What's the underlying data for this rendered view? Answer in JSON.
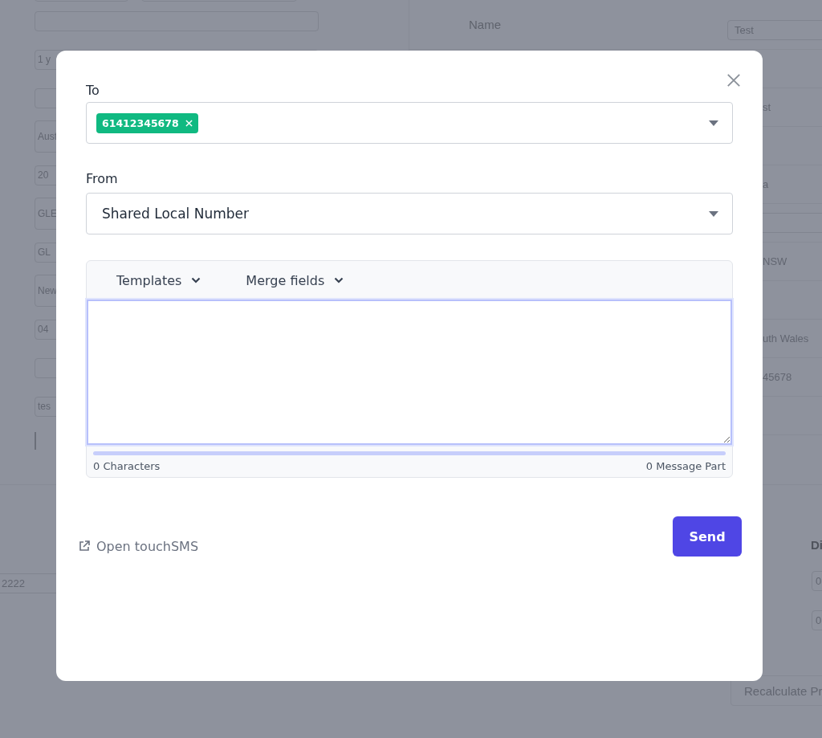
{
  "background": {
    "left_fields": [
      {
        "kind": "blank"
      },
      {
        "kind": "text",
        "value": "1 y"
      },
      {
        "kind": "blank"
      },
      {
        "kind": "text",
        "value": "Aust"
      },
      {
        "kind": "text",
        "value": "20"
      },
      {
        "kind": "text",
        "value": "GLE"
      },
      {
        "kind": "text",
        "value": "GL"
      },
      {
        "kind": "text",
        "value": "New"
      },
      {
        "kind": "text",
        "value": "04"
      },
      {
        "kind": "blank"
      },
      {
        "kind": "text",
        "value": "tes"
      }
    ],
    "right_label": "Name",
    "right_fields": [
      {
        "kind": "text",
        "value": "Test"
      },
      {
        "kind": "blank"
      },
      {
        "kind": "text",
        "value": "st"
      },
      {
        "kind": "blank"
      },
      {
        "kind": "text",
        "value": "a"
      },
      {
        "kind": "blank"
      },
      {
        "kind": "text",
        "value": "NSW"
      },
      {
        "kind": "blank"
      },
      {
        "kind": "text",
        "value": "uth Wales"
      },
      {
        "kind": "text",
        "value": "45678"
      },
      {
        "kind": "blank"
      }
    ],
    "bottom_left_field": "2222",
    "bottom_right_header": "Di",
    "bottom_right_fields": [
      "0",
      "0"
    ],
    "recalculate_button": "Recalculate Pr"
  },
  "dialog": {
    "to_label": "To",
    "recipients": [
      {
        "label": "61412345678"
      }
    ],
    "from_label": "From",
    "from_value": "Shared Local Number",
    "toolbar": [
      "Templates",
      "Merge fields"
    ],
    "usage_meter": {
      "level": 0
    },
    "character_count": "0 Characters",
    "message_parts": "0 Message Part",
    "open_link": "Open touchSMS",
    "send_button": "Send"
  }
}
